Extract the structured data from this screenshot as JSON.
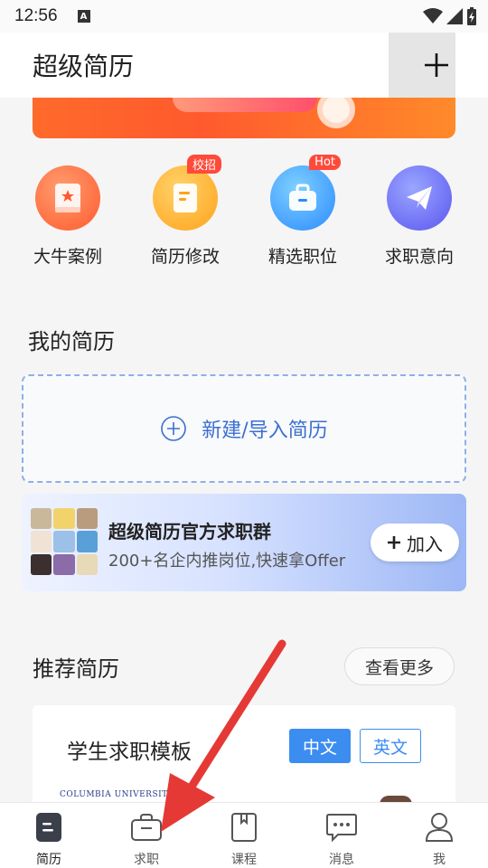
{
  "status": {
    "time": "12:56",
    "notif_icon": "A"
  },
  "header": {
    "title": "超级简历",
    "add_icon": "plus-icon"
  },
  "quick_actions": [
    {
      "label": "大牛案例",
      "icon": "star-book-icon"
    },
    {
      "label": "简历修改",
      "icon": "document-icon",
      "badge": "校招"
    },
    {
      "label": "精选职位",
      "icon": "briefcase-icon",
      "badge": "Hot"
    },
    {
      "label": "求职意向",
      "icon": "paper-plane-icon"
    }
  ],
  "my_resumes": {
    "title": "我的简历",
    "new_label": "新建/导入简历"
  },
  "group": {
    "title": "超级简历官方求职群",
    "subtitle": "200+名企内推岗位,快速拿Offer",
    "join_label": "加入"
  },
  "recommended": {
    "title": "推荐简历",
    "more_label": "查看更多",
    "card_title": "学生求职模板",
    "lang_cn": "中文",
    "lang_en": "英文",
    "preview_text": "COLUMBIA UNIVERSITY"
  },
  "tabs": [
    {
      "label": "简历",
      "icon": "resume-icon",
      "active": true
    },
    {
      "label": "求职",
      "icon": "briefcase-icon",
      "active": false
    },
    {
      "label": "课程",
      "icon": "book-icon",
      "active": false
    },
    {
      "label": "消息",
      "icon": "chat-icon",
      "active": false
    },
    {
      "label": "我",
      "icon": "user-icon",
      "active": false
    }
  ],
  "colors": {
    "accent": "#3c8df0",
    "arrow": "#e53935"
  }
}
